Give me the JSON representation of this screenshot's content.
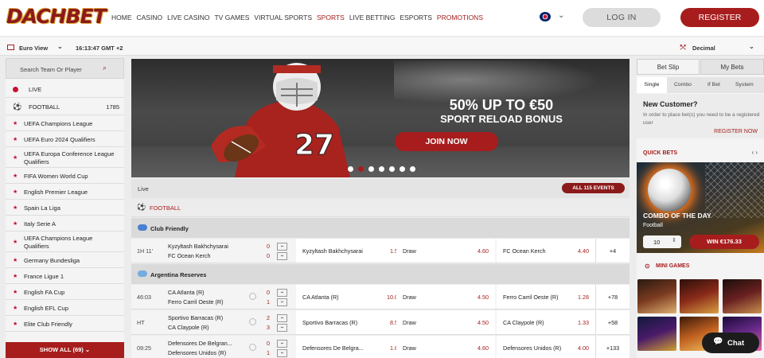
{
  "brand": {
    "logo_text": "DACHBET",
    "accent": "#a71d1d"
  },
  "nav": {
    "items": [
      {
        "label": "HOME",
        "active": false
      },
      {
        "label": "CASINO",
        "active": false
      },
      {
        "label": "LIVE CASINO",
        "active": false
      },
      {
        "label": "TV GAMES",
        "active": false
      },
      {
        "label": "VIRTUAL SPORTS",
        "active": false
      },
      {
        "label": "SPORTS",
        "active": true
      },
      {
        "label": "LIVE BETTING",
        "active": false
      },
      {
        "label": "ESPORTS",
        "active": false
      },
      {
        "label": "PROMOTIONS",
        "active": true
      }
    ],
    "language_icon": "uk-flag-icon",
    "login": "LOG IN",
    "register": "REGISTER"
  },
  "subbar": {
    "view": "Euro View",
    "time": "16:13:47 GMT +2",
    "odds_format": "Decimal"
  },
  "sidebar": {
    "search_placeholder": "Search Team Or Player",
    "live": "LIVE",
    "football": {
      "label": "FOOTBALL",
      "count": "1785"
    },
    "leagues": [
      "UEFA Champions League",
      "UEFA Euro 2024 Qualifiers",
      "UEFA Europa Conference League Qualifiers",
      "FIFA Women World Cup",
      "English Premier League",
      "Spain La Liga",
      "Italy Serie A",
      "UEFA Champions League Qualifiers",
      "Germany Bundesliga",
      "France Ligue 1",
      "English FA Cup",
      "English EFL Cup",
      "Elite Club Friendly"
    ],
    "show_all": "SHOW ALL (69)"
  },
  "banner": {
    "headline": "50% UP TO €50",
    "subline": "SPORT RELOAD BONUS",
    "cta": "JOIN NOW",
    "jersey_number": "27",
    "slides": 7,
    "active_slide": 2
  },
  "live": {
    "label": "Live",
    "all_events": "ALL 115 EVENTS",
    "sport": "FOOTBALL",
    "groups": [
      {
        "league": "Club Friendly",
        "flag_color": "#4a7fd1",
        "matches": [
          {
            "time": "1H 11'",
            "home": "Kyzyltash Bakhchysarai",
            "away": "FC Ocean Kerch",
            "score_home": "0",
            "score_away": "0",
            "odds": [
              {
                "name": "Kyzyltash Bakhchysarai",
                "value": "1.50"
              },
              {
                "name": "Draw",
                "value": "4.60"
              },
              {
                "name": "FC Ocean Kerch",
                "value": "4.40"
              }
            ],
            "more": "+4"
          }
        ]
      },
      {
        "league": "Argentina Reserves",
        "flag_color": "#74acdf",
        "matches": [
          {
            "time": "46:03",
            "home": "CA Atlanta (R)",
            "away": "Ferro Carril Oeste (R)",
            "score_home": "0",
            "score_away": "1",
            "odds": [
              {
                "name": "CA Atlanta (R)",
                "value": "10.00"
              },
              {
                "name": "Draw",
                "value": "4.50"
              },
              {
                "name": "Ferro Carril Oeste (R)",
                "value": "1.28"
              }
            ],
            "more": "+78"
          },
          {
            "time": "HT",
            "home": "Sportivo Barracas (R)",
            "away": "CA Claypole (R)",
            "score_home": "2",
            "score_away": "3",
            "odds": [
              {
                "name": "Sportivo Barracas (R)",
                "value": "8.50"
              },
              {
                "name": "Draw",
                "value": "4.50"
              },
              {
                "name": "CA Claypole (R)",
                "value": "1.33"
              }
            ],
            "more": "+58"
          },
          {
            "time": "09:25",
            "home": "Defensores De Belgran...",
            "away": "Defensores Unidos (R)",
            "score_home": "0",
            "score_away": "1",
            "odds": [
              {
                "name": "Defensores De Belgra...",
                "value": "1.60"
              },
              {
                "name": "Draw",
                "value": "4.60"
              },
              {
                "name": "Defensores Unidos (R)",
                "value": "4.00"
              }
            ],
            "more": "+133"
          }
        ]
      }
    ]
  },
  "betslip": {
    "tabs": [
      "Bet Slip",
      "My Bets"
    ],
    "types": [
      "Single",
      "Combo",
      "If Bet",
      "System"
    ],
    "new_customer_title": "New Customer?",
    "new_customer_text": "In order to place bet(s) you need to be a registered user",
    "register_now": "REGISTER NOW"
  },
  "quick_bets": {
    "title": "QUICK BETS",
    "combo_title": "COMBO OF THE DAY",
    "sport": "Football",
    "stake": "10",
    "win_button": "WIN €176.33"
  },
  "mini_games": {
    "title": "MINI GAMES"
  },
  "chat": {
    "label": "Chat"
  }
}
